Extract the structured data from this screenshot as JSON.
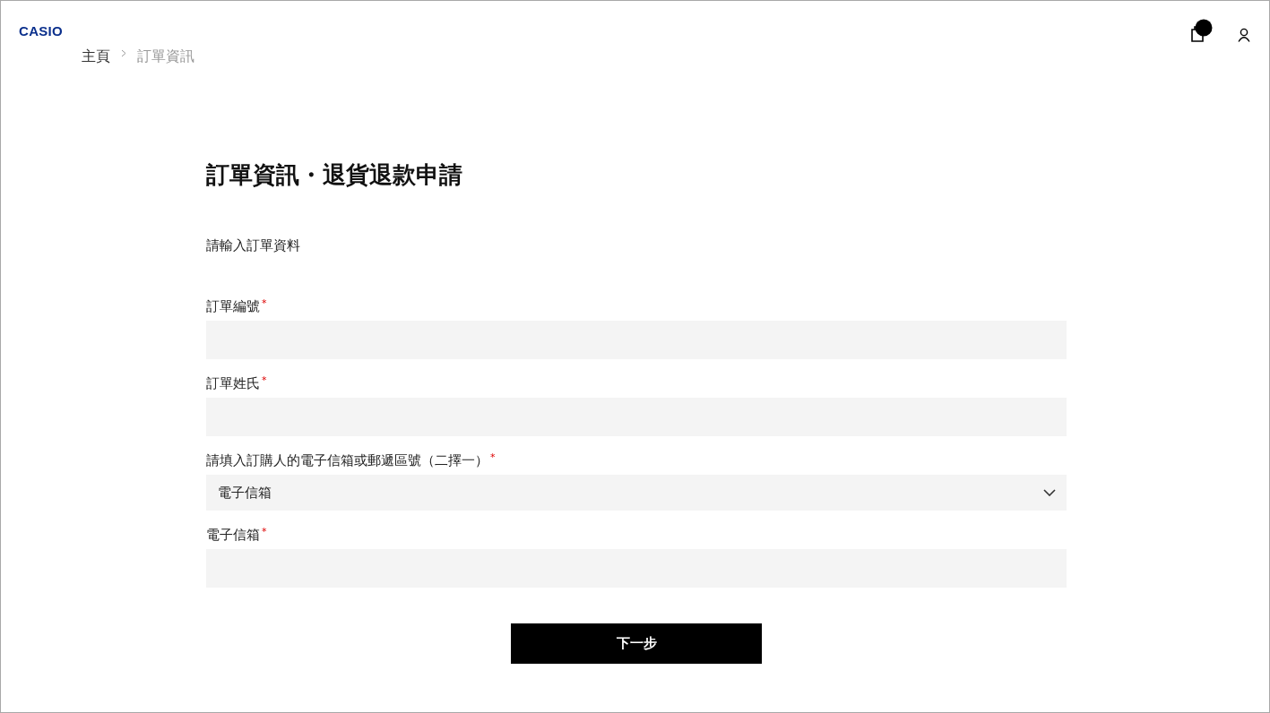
{
  "header": {
    "logo": "CASIO"
  },
  "breadcrumb": [
    {
      "label": "主頁",
      "current": false
    },
    {
      "label": "訂單資訊",
      "current": true
    }
  ],
  "title": "訂單資訊・退貨退款申請",
  "intro": "請輸入訂單資料",
  "fields": [
    {
      "kind": "text",
      "label": "訂單編號",
      "required_mark": "*"
    },
    {
      "kind": "text",
      "label": "訂單姓氏",
      "required_mark": "*"
    },
    {
      "kind": "select",
      "label": "請填入訂購人的電子信箱或郵遞區號（二擇一）",
      "required_mark": "*",
      "value": "電子信箱"
    },
    {
      "kind": "text",
      "label": "電子信箱",
      "required_mark": "*"
    }
  ],
  "submit": "下一步"
}
